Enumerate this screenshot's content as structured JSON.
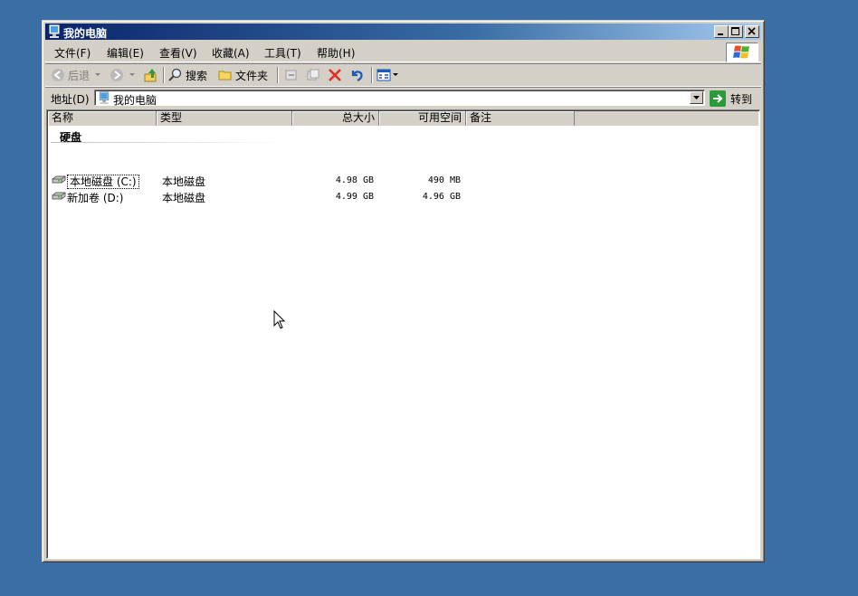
{
  "window": {
    "title": "我的电脑",
    "caption_buttons": [
      "minimize",
      "maximize",
      "close"
    ]
  },
  "menu": [
    "文件(F)",
    "编辑(E)",
    "查看(V)",
    "收藏(A)",
    "工具(T)",
    "帮助(H)"
  ],
  "toolbar": {
    "back_label": "后退",
    "search_label": "搜索",
    "folders_label": "文件夹"
  },
  "address": {
    "label": "地址(D)",
    "value": "我的电脑",
    "go_label": "转到"
  },
  "columns": [
    "名称",
    "类型",
    "总大小",
    "可用空间",
    "备注"
  ],
  "group": "硬盘",
  "drives": [
    {
      "name": "本地磁盘 (C:)",
      "type": "本地磁盘",
      "total": "4.98 GB",
      "free": "490 MB",
      "comment": ""
    },
    {
      "name": "新加卷 (D:)",
      "type": "本地磁盘",
      "total": "4.99 GB",
      "free": "4.96 GB",
      "comment": ""
    }
  ],
  "colors": {
    "desktop": "#3a6ea5",
    "titlebar_start": "#0a246a",
    "face": "#d4d0c8",
    "delete_red": "#e03020",
    "go_green": "#2a9a3a"
  }
}
